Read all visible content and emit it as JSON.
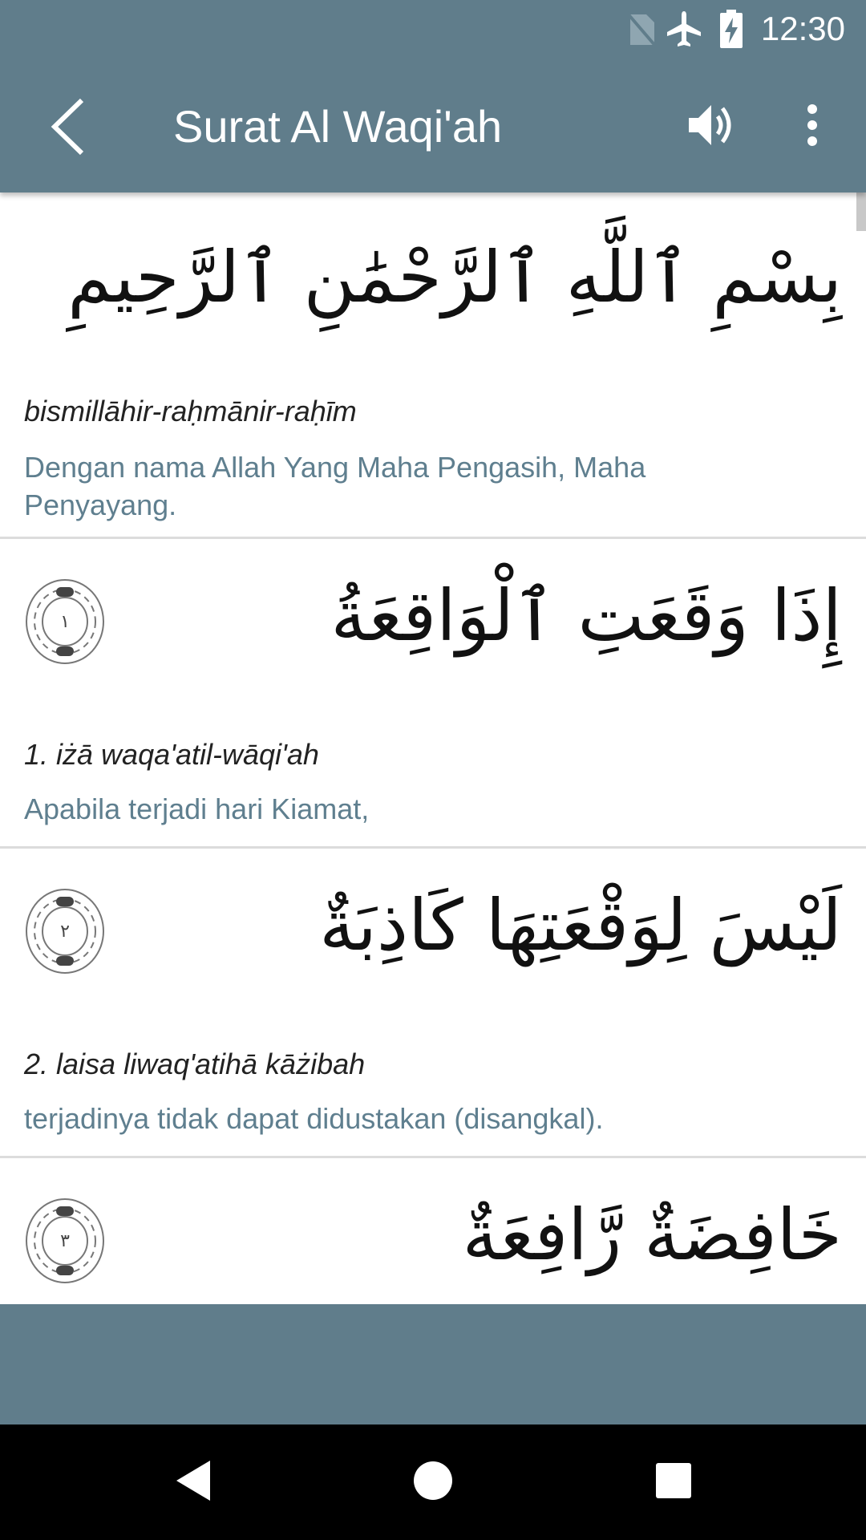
{
  "status_bar": {
    "time": "12:30",
    "icons": [
      "no-sim-icon",
      "airplane-mode-icon",
      "battery-charging-icon"
    ]
  },
  "toolbar": {
    "title": "Surat Al Waqi'ah",
    "back_icon": "back-arrow-icon",
    "sound_icon": "volume-icon",
    "menu_icon": "more-vert-icon"
  },
  "basmala": {
    "arabic": "بِسْمِ ٱللَّهِ ٱلرَّحْمَٰنِ ٱلرَّحِيمِ",
    "latin": "bismillāhir-raḥmānir-raḥīm",
    "translation": "Dengan nama Allah Yang Maha Pengasih, Maha Penyayang."
  },
  "verses": [
    {
      "number": "١",
      "arabic": "إِذَا وَقَعَتِ ٱلْوَاقِعَةُ",
      "latin": "1. iżā waqa'atil-wāqi'ah",
      "translation": "Apabila terjadi hari Kiamat,"
    },
    {
      "number": "٢",
      "arabic": "لَيْسَ لِوَقْعَتِهَا كَاذِبَةٌ",
      "latin": "2. laisa liwaq'atihā kāżibah",
      "translation": "terjadinya tidak dapat didustakan (disangkal)."
    },
    {
      "number": "٣",
      "arabic": "خَافِضَةٌ رَّافِعَةٌ",
      "latin": "",
      "translation": ""
    }
  ],
  "nav_bar": {
    "icons": [
      "nav-back-icon",
      "nav-home-icon",
      "nav-recents-icon"
    ]
  },
  "colors": {
    "primary": "#607d8b",
    "translation_text": "#5f7f8f",
    "divider": "#dcdcdc"
  }
}
